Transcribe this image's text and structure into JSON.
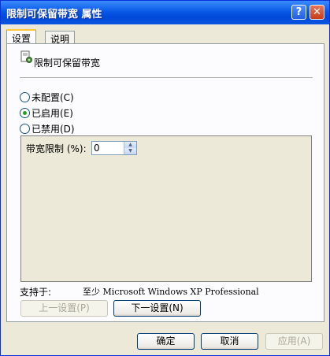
{
  "window": {
    "title": "限制可保留带宽 属性",
    "help_glyph": "?",
    "close_glyph": "✕"
  },
  "tabs": [
    {
      "label": "设置",
      "active": true
    },
    {
      "label": "说明",
      "active": false
    }
  ],
  "policy": {
    "name": "限制可保留带宽",
    "icon": "policy-setting-icon"
  },
  "options": {
    "not_configured": "未配置(C)",
    "enabled": "已启用(E)",
    "disabled": "已禁用(D)",
    "selected": "enabled"
  },
  "bandwidth": {
    "label": "带宽限制 (%):",
    "value": "0"
  },
  "supported": {
    "label": "支持于:",
    "value": "至少 Microsoft Windows XP Professional"
  },
  "nav": {
    "prev_label": "上一设置(P)",
    "next_label": "下一设置(N)"
  },
  "footer": {
    "ok_label": "确定",
    "cancel_label": "取消",
    "apply_label": "应用(A)"
  },
  "colors": {
    "titlebar": "#0a59e6",
    "dialog_bg": "#ece9d8",
    "panel_bg": "#fcfcfe",
    "radio_dot": "#21a121",
    "tab_highlight": "#ffc83c"
  }
}
